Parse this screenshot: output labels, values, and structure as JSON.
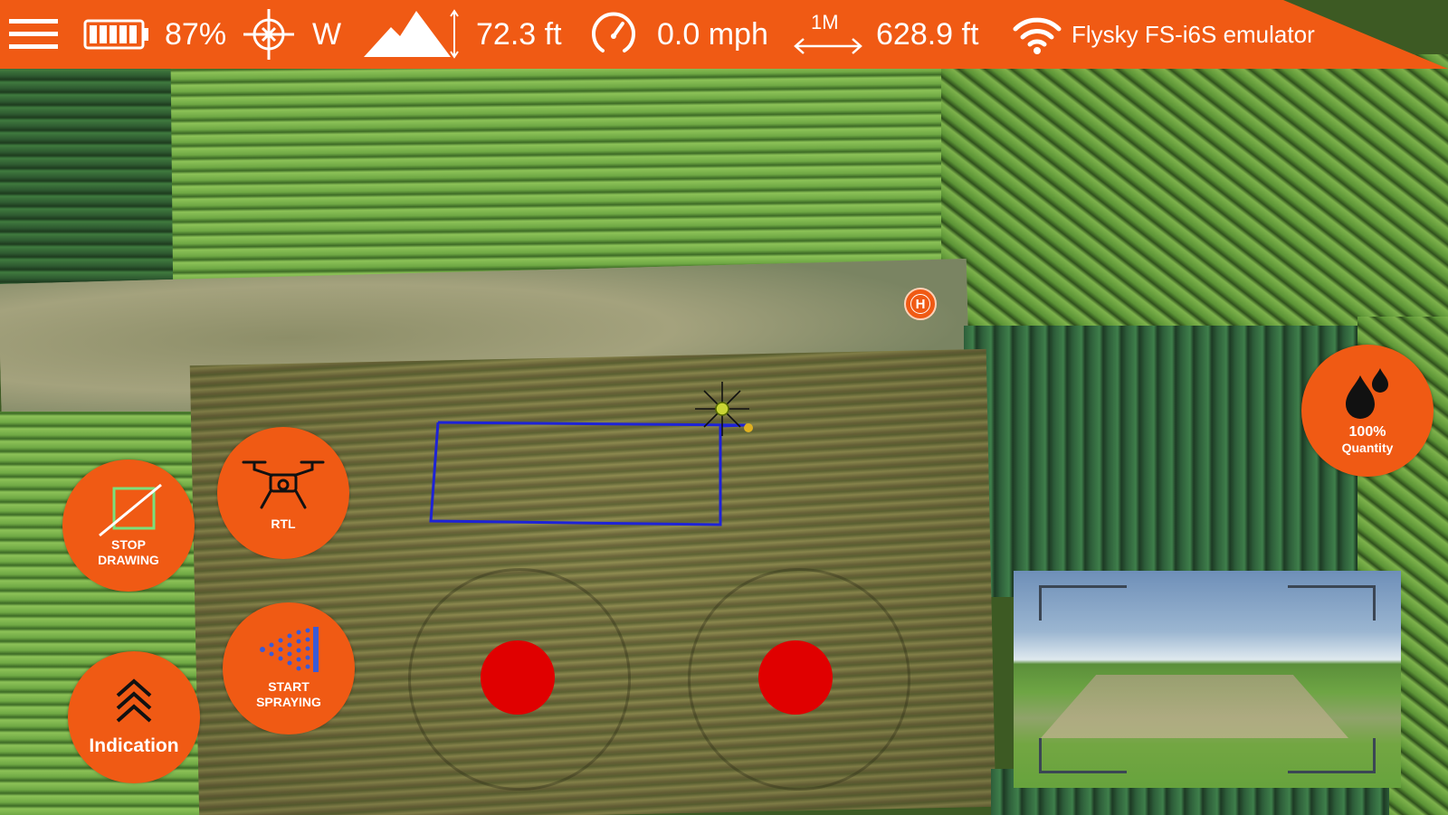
{
  "status_bar": {
    "menu_icon": "hamburger-menu-icon",
    "battery_icon": "battery-icon",
    "battery_percent": "87%",
    "compass_icon": "compass-crosshair-icon",
    "heading": "W",
    "altitude_icon": "mountain-altitude-icon",
    "altitude": "72.3 ft",
    "speed_icon": "speedometer-icon",
    "speed": "0.0 mph",
    "distance_scale_label": "1M",
    "distance_icon": "distance-arrow-icon",
    "distance": "628.9 ft",
    "signal_icon": "wifi-signal-icon",
    "controller": "Flysky FS-i6S emulator",
    "accent_color": "#f05a14"
  },
  "controls": {
    "stop_drawing": "STOP\nDRAWING",
    "rtl": "RTL",
    "start_spraying": "START\nSPRAYING",
    "indication": "Indication",
    "quantity_percent": "100%",
    "quantity_label": "Quantity"
  },
  "map": {
    "home_marker_letter": "H",
    "path_color": "#1e23d6"
  },
  "joysticks": {
    "knob_color": "#e00000"
  }
}
